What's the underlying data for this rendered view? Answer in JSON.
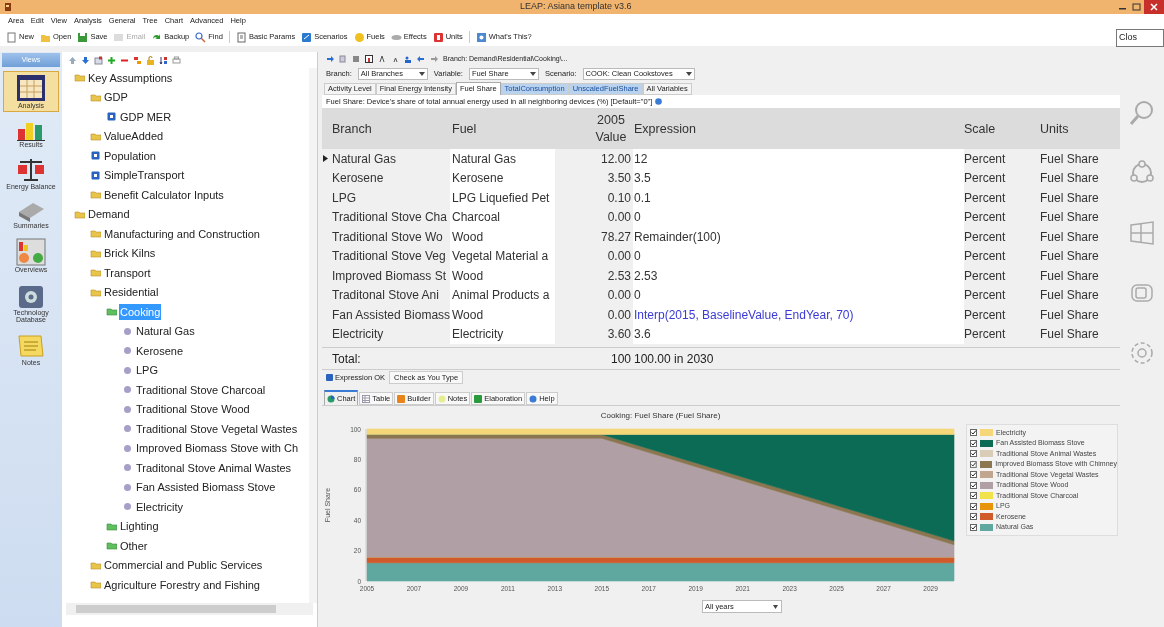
{
  "window": {
    "title": "LEAP: Asiana template v3.6"
  },
  "tooltip": "Clos",
  "menu": [
    "Area",
    "Edit",
    "View",
    "Analysis",
    "General",
    "Tree",
    "Chart",
    "Advanced",
    "Help"
  ],
  "toolbar": [
    {
      "label": "New",
      "kind": "new",
      "disabled": false
    },
    {
      "label": "Open",
      "kind": "open",
      "disabled": false
    },
    {
      "label": "Save",
      "kind": "save",
      "disabled": false
    },
    {
      "label": "Email",
      "kind": "email",
      "disabled": true
    },
    {
      "label": "Backup",
      "kind": "backup",
      "disabled": false
    },
    {
      "label": "Find",
      "kind": "find",
      "disabled": false
    },
    {
      "label": "Basic Params",
      "kind": "params",
      "disabled": false
    },
    {
      "label": "Scenarios",
      "kind": "scenarios",
      "disabled": false
    },
    {
      "label": "Fuels",
      "kind": "fuels",
      "disabled": false
    },
    {
      "label": "Effects",
      "kind": "effects",
      "disabled": false
    },
    {
      "label": "Units",
      "kind": "units",
      "disabled": false
    },
    {
      "label": "What's This?",
      "kind": "help",
      "disabled": false
    }
  ],
  "views": {
    "title": "Views",
    "items": [
      {
        "label": "Analysis",
        "kind": "analysis",
        "selected": true
      },
      {
        "label": "Results",
        "kind": "results",
        "selected": false
      },
      {
        "label": "Energy Balance",
        "kind": "balance",
        "selected": false
      },
      {
        "label": "Summaries",
        "kind": "summaries",
        "selected": false
      },
      {
        "label": "Overviews",
        "kind": "overviews",
        "selected": false
      },
      {
        "label": "Technology Database",
        "kind": "database",
        "selected": false
      },
      {
        "label": "Notes",
        "kind": "notes",
        "selected": false
      }
    ]
  },
  "tree": [
    {
      "label": "Key Assumptions",
      "kind": "folder",
      "selected": false,
      "children": [
        {
          "label": "GDP",
          "kind": "folder",
          "selected": false,
          "children": [
            {
              "label": "GDP MER",
              "kind": "variable",
              "selected": false
            }
          ]
        },
        {
          "label": "ValueAdded",
          "kind": "folder",
          "selected": false
        },
        {
          "label": "Population",
          "kind": "variable",
          "selected": false
        },
        {
          "label": "SimpleTransport",
          "kind": "variable",
          "selected": false
        },
        {
          "label": "Benefit Calculator Inputs",
          "kind": "folder",
          "selected": false
        }
      ]
    },
    {
      "label": "Demand",
      "kind": "folder",
      "selected": false,
      "children": [
        {
          "label": "Manufacturing and Construction",
          "kind": "folder",
          "selected": false
        },
        {
          "label": "Brick Kilns",
          "kind": "folder",
          "selected": false
        },
        {
          "label": "Transport",
          "kind": "folder",
          "selected": false
        },
        {
          "label": "Residential",
          "kind": "folder",
          "selected": false,
          "children": [
            {
              "label": "Cooking",
              "kind": "category",
              "selected": true,
              "children": [
                {
                  "label": "Natural Gas",
                  "kind": "device",
                  "selected": false
                },
                {
                  "label": "Kerosene",
                  "kind": "device",
                  "selected": false
                },
                {
                  "label": "LPG",
                  "kind": "device",
                  "selected": false
                },
                {
                  "label": "Traditional Stove Charcoal",
                  "kind": "device",
                  "selected": false
                },
                {
                  "label": "Traditional Stove Wood",
                  "kind": "device",
                  "selected": false
                },
                {
                  "label": "Traditional Stove Vegetal Wastes",
                  "kind": "device",
                  "selected": false
                },
                {
                  "label": "Improved Biomass Stove with Ch",
                  "kind": "device",
                  "selected": false
                },
                {
                  "label": "Traditonal Stove Animal Wastes",
                  "kind": "device",
                  "selected": false
                },
                {
                  "label": "Fan Assisted Biomass Stove",
                  "kind": "device",
                  "selected": false
                },
                {
                  "label": "Electricity",
                  "kind": "device",
                  "selected": false
                }
              ]
            },
            {
              "label": "Lighting",
              "kind": "category",
              "selected": false
            },
            {
              "label": "Other",
              "kind": "category",
              "selected": false
            }
          ]
        },
        {
          "label": "Commercial and Public Services",
          "kind": "folder",
          "selected": false
        },
        {
          "label": "Agriculture Forestry and Fishing",
          "kind": "folder",
          "selected": false
        }
      ]
    }
  ],
  "branch_path": "Branch: Demand\\Residential\\Cooking\\...",
  "filters": [
    {
      "label": "Branch:",
      "value": "All Branches"
    },
    {
      "label": "Variable:",
      "value": "Fuel Share"
    },
    {
      "label": "Scenario:",
      "value": "COOK: Clean Cookstoves"
    }
  ],
  "variable_tabs": [
    {
      "label": "Activity Level",
      "selected": false,
      "highlighted": false
    },
    {
      "label": "Final Energy Intensity",
      "selected": false,
      "highlighted": false
    },
    {
      "label": "Fuel Share",
      "selected": true,
      "highlighted": false
    },
    {
      "label": "TotalConsumption",
      "selected": false,
      "highlighted": true
    },
    {
      "label": "UnscaledFuelShare",
      "selected": false,
      "highlighted": true
    },
    {
      "label": "All Variables",
      "selected": false,
      "highlighted": false
    }
  ],
  "description": "Fuel Share: Device's share of total annual energy used in all neighboring devices (%) [Default=\"0\"]",
  "table": {
    "columns": [
      "Branch",
      "Fuel",
      "2005 Value",
      "Expression",
      "Scale",
      "Units"
    ],
    "rows": [
      {
        "branch": "Natural Gas",
        "fuel": "Natural Gas",
        "value": "12.00",
        "expression": "12",
        "kind": "number",
        "scale": "Percent",
        "units": "Fuel Share",
        "selected": true
      },
      {
        "branch": "Kerosene",
        "fuel": "Kerosene",
        "value": "3.50",
        "expression": "3.5",
        "kind": "number",
        "scale": "Percent",
        "units": "Fuel Share",
        "selected": false
      },
      {
        "branch": "LPG",
        "fuel": "LPG Liquefied Pet",
        "value": "0.10",
        "expression": "0.1",
        "kind": "number",
        "scale": "Percent",
        "units": "Fuel Share",
        "selected": false
      },
      {
        "branch": "Traditional Stove Cha",
        "fuel": "Charcoal",
        "value": "0.00",
        "expression": "0",
        "kind": "number",
        "scale": "Percent",
        "units": "Fuel Share",
        "selected": false
      },
      {
        "branch": "Traditional Stove Wo",
        "fuel": "Wood",
        "value": "78.27",
        "expression": "Remainder(100)",
        "kind": "number",
        "scale": "Percent",
        "units": "Fuel Share",
        "selected": false
      },
      {
        "branch": "Traditional Stove Veg",
        "fuel": "Vegetal Material a",
        "value": "0.00",
        "expression": "0",
        "kind": "number",
        "scale": "Percent",
        "units": "Fuel Share",
        "selected": false
      },
      {
        "branch": "Improved Biomass St",
        "fuel": "Wood",
        "value": "2.53",
        "expression": "2.53",
        "kind": "number",
        "scale": "Percent",
        "units": "Fuel Share",
        "selected": false
      },
      {
        "branch": "Traditonal Stove Ani",
        "fuel": "Animal Products a",
        "value": "0.00",
        "expression": "0",
        "kind": "number",
        "scale": "Percent",
        "units": "Fuel Share",
        "selected": false
      },
      {
        "branch": "Fan Assisted Biomass",
        "fuel": "Wood",
        "value": "0.00",
        "expression": "Interp(2015, BaselineValue, EndYear, 70)",
        "kind": "function",
        "scale": "Percent",
        "units": "Fuel Share",
        "selected": false
      },
      {
        "branch": "Electricity",
        "fuel": "Electricity",
        "value": "3.60",
        "expression": "3.6",
        "kind": "number",
        "scale": "Percent",
        "units": "Fuel Share",
        "selected": false
      }
    ],
    "total": {
      "label": "Total:",
      "value": "100",
      "expression": "100.00 in 2030"
    }
  },
  "status": [
    {
      "label": "Expression OK",
      "kind": "ok"
    },
    {
      "label": "Check as You Type",
      "kind": "toggle"
    }
  ],
  "chart_tabs": [
    {
      "label": "Chart",
      "kind": "chart",
      "selected": true
    },
    {
      "label": "Table",
      "kind": "table",
      "selected": false
    },
    {
      "label": "Builder",
      "kind": "builder",
      "selected": false
    },
    {
      "label": "Notes",
      "kind": "notes",
      "selected": false
    },
    {
      "label": "Elaboration",
      "kind": "elaboration",
      "selected": false
    },
    {
      "label": "Help",
      "kind": "help",
      "selected": false
    }
  ],
  "chart_data": {
    "type": "area",
    "stacked": true,
    "title": "Cooking: Fuel Share (Fuel Share)",
    "ylabel": "Fuel Share",
    "x": [
      2005,
      2015,
      2030
    ],
    "xlim": [
      2005,
      2030
    ],
    "ylim": [
      0,
      100
    ],
    "xticks": [
      2005,
      2007,
      2009,
      2011,
      2013,
      2015,
      2017,
      2019,
      2021,
      2023,
      2025,
      2027,
      2029
    ],
    "yticks": [
      0,
      20,
      40,
      60,
      80,
      100
    ],
    "series": [
      {
        "name": "Natural Gas",
        "color": "#5fa8a0",
        "values": [
          12,
          12,
          12
        ]
      },
      {
        "name": "Kerosene",
        "color": "#d05a2a",
        "values": [
          3.5,
          3.5,
          3.5
        ]
      },
      {
        "name": "LPG",
        "color": "#e8940a",
        "values": [
          0.1,
          0.1,
          0.1
        ]
      },
      {
        "name": "Traditional Stove Charcoal",
        "color": "#f2e24a",
        "values": [
          null,
          null,
          null
        ]
      },
      {
        "name": "Traditional Stove Wood",
        "color": "#b0a0a5",
        "values": [
          78.3,
          78.3,
          8.3
        ]
      },
      {
        "name": "Traditional Stove Vegetal Wastes",
        "color": "#c2a58e",
        "values": [
          null,
          null,
          null
        ]
      },
      {
        "name": "Improved Biomass Stove with Chimney",
        "color": "#8b7650",
        "values": [
          2.5,
          2.5,
          2.5
        ]
      },
      {
        "name": "Traditional Stove Animal Wastes",
        "color": "#d9cdb8",
        "values": [
          null,
          null,
          null
        ]
      },
      {
        "name": "Fan Assisted Biomass Stove",
        "color": "#0b6b55",
        "values": [
          0,
          0,
          70
        ]
      },
      {
        "name": "Electricity",
        "color": "#f5d77a",
        "values": [
          3.6,
          3.6,
          3.6
        ]
      }
    ]
  },
  "legend": [
    {
      "checked": true
    },
    {
      "checked": true
    },
    {
      "checked": true
    },
    {
      "checked": true
    },
    {
      "checked": true
    },
    {
      "checked": true
    },
    {
      "checked": true
    },
    {
      "checked": true
    },
    {
      "checked": true
    },
    {
      "checked": true
    }
  ],
  "year_select": "All years"
}
